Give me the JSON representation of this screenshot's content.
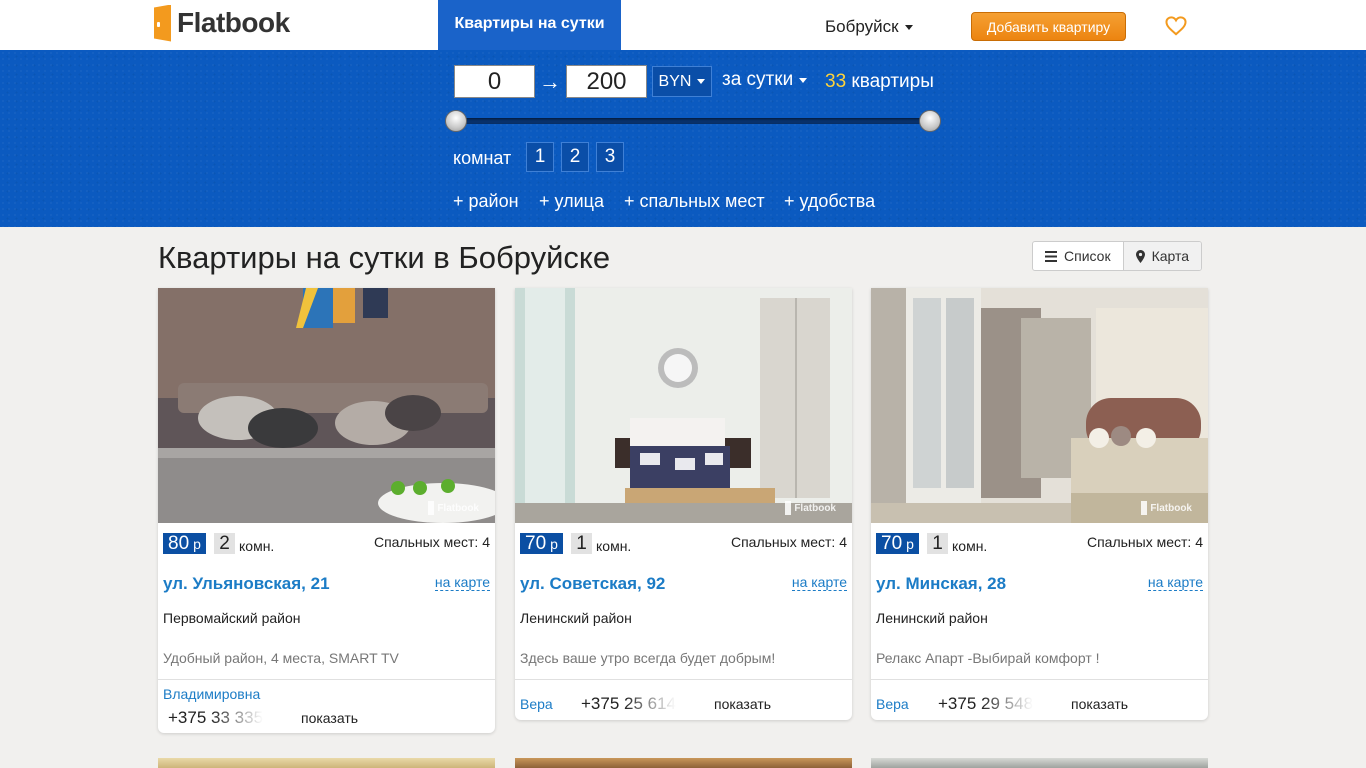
{
  "header": {
    "logo_text": "Flatbook",
    "nav_active": "Квартиры на сутки",
    "city": "Бобруйск",
    "add_button": "Добавить квартиру"
  },
  "filters": {
    "price_min": "0",
    "price_max": "200",
    "arrow": "→",
    "currency": "BYN",
    "period": "за сутки",
    "count": "33",
    "count_label": "квартиры",
    "rooms_label": "комнат",
    "rooms": [
      "1",
      "2",
      "3"
    ],
    "more": [
      "+ район",
      "+ улица",
      "+ спальных мест",
      "+ удобства"
    ]
  },
  "content": {
    "title": "Квартиры на сутки в Бобруйске",
    "view_list": "Список",
    "view_map": "Карта"
  },
  "cards": [
    {
      "price": "80",
      "currency": "р",
      "rooms": "2",
      "rooms_label": "комн.",
      "beds": "Спальных мест: 4",
      "address": "ул. Ульяновская, 21",
      "map_link": "на карте",
      "district": "Первомайский район",
      "description": "Удобный район, 4 места, SMART TV",
      "owner": "Владимировна",
      "phone_prefix": "+375",
      "phone_part": "33 335",
      "show": "показать"
    },
    {
      "price": "70",
      "currency": "р",
      "rooms": "1",
      "rooms_label": "комн.",
      "beds": "Спальных мест: 4",
      "address": "ул. Советская, 92",
      "map_link": "на карте",
      "district": "Ленинский район",
      "description": "Здесь ваше утро всегда будет добрым!",
      "owner": "Вера",
      "phone_prefix": "+375",
      "phone_part": "25 614",
      "show": "показать"
    },
    {
      "price": "70",
      "currency": "р",
      "rooms": "1",
      "rooms_label": "комн.",
      "beds": "Спальных мест: 4",
      "address": "ул. Минская, 28",
      "map_link": "на карте",
      "district": "Ленинский район",
      "description": "Релакс Апарт -Выбирай комфорт !",
      "owner": "Вера",
      "phone_prefix": "+375",
      "phone_part": "29 548",
      "show": "показать"
    }
  ],
  "photo_watermark": "Flatbook",
  "icons": {
    "heart": "heart-icon",
    "list": "list-icon",
    "map": "map-marker-icon"
  },
  "colors": {
    "accent_blue": "#1a63c9",
    "filter_bg": "#0b5ac0",
    "button_orange": "#ec8410",
    "link_blue": "#1c7cc6",
    "price_badge": "#0b4fa3",
    "count_yellow": "#ffd43a"
  }
}
